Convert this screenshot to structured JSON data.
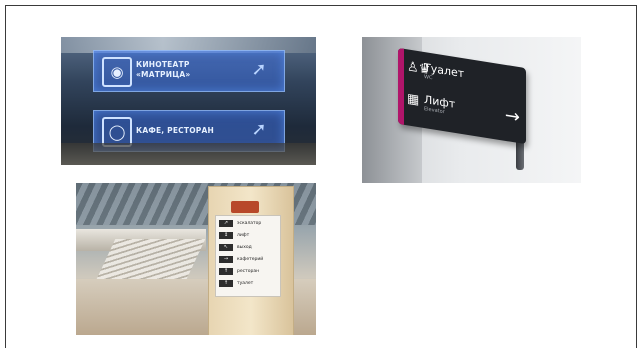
{
  "photos": {
    "hanging_signs": {
      "sign_top": {
        "line1": "КИНОТЕАТР",
        "line2": "«МАТРИЦА»",
        "icon": "film-camera-icon",
        "right_icon": "escalator-icon"
      },
      "sign_bottom": {
        "line1": "КАФЕ, РЕСТОРАН",
        "icon": "restaurant-icon",
        "right_icon": "escalator-icon"
      },
      "glow_color": "#3c6edc"
    },
    "blade_sign": {
      "row1": {
        "main": "Туалет",
        "sub": "WC",
        "icon": "restroom-icon"
      },
      "row2": {
        "main": "Лифт",
        "sub": "Elevator",
        "icon": "elevator-icon"
      },
      "arrow": "→",
      "accent_color": "#b0156a"
    },
    "totem": {
      "items": [
        {
          "label": "эскалатор",
          "icon": "escalator-icon"
        },
        {
          "label": "лифт",
          "icon": "elevator-icon"
        },
        {
          "label": "выход",
          "icon": "exit-icon"
        },
        {
          "label": "кафетерий",
          "icon": "cafe-icon"
        },
        {
          "label": "ресторан",
          "icon": "restaurant-icon"
        },
        {
          "label": "туалет",
          "icon": "restroom-icon"
        }
      ],
      "logo_color": "#b8492a"
    }
  }
}
